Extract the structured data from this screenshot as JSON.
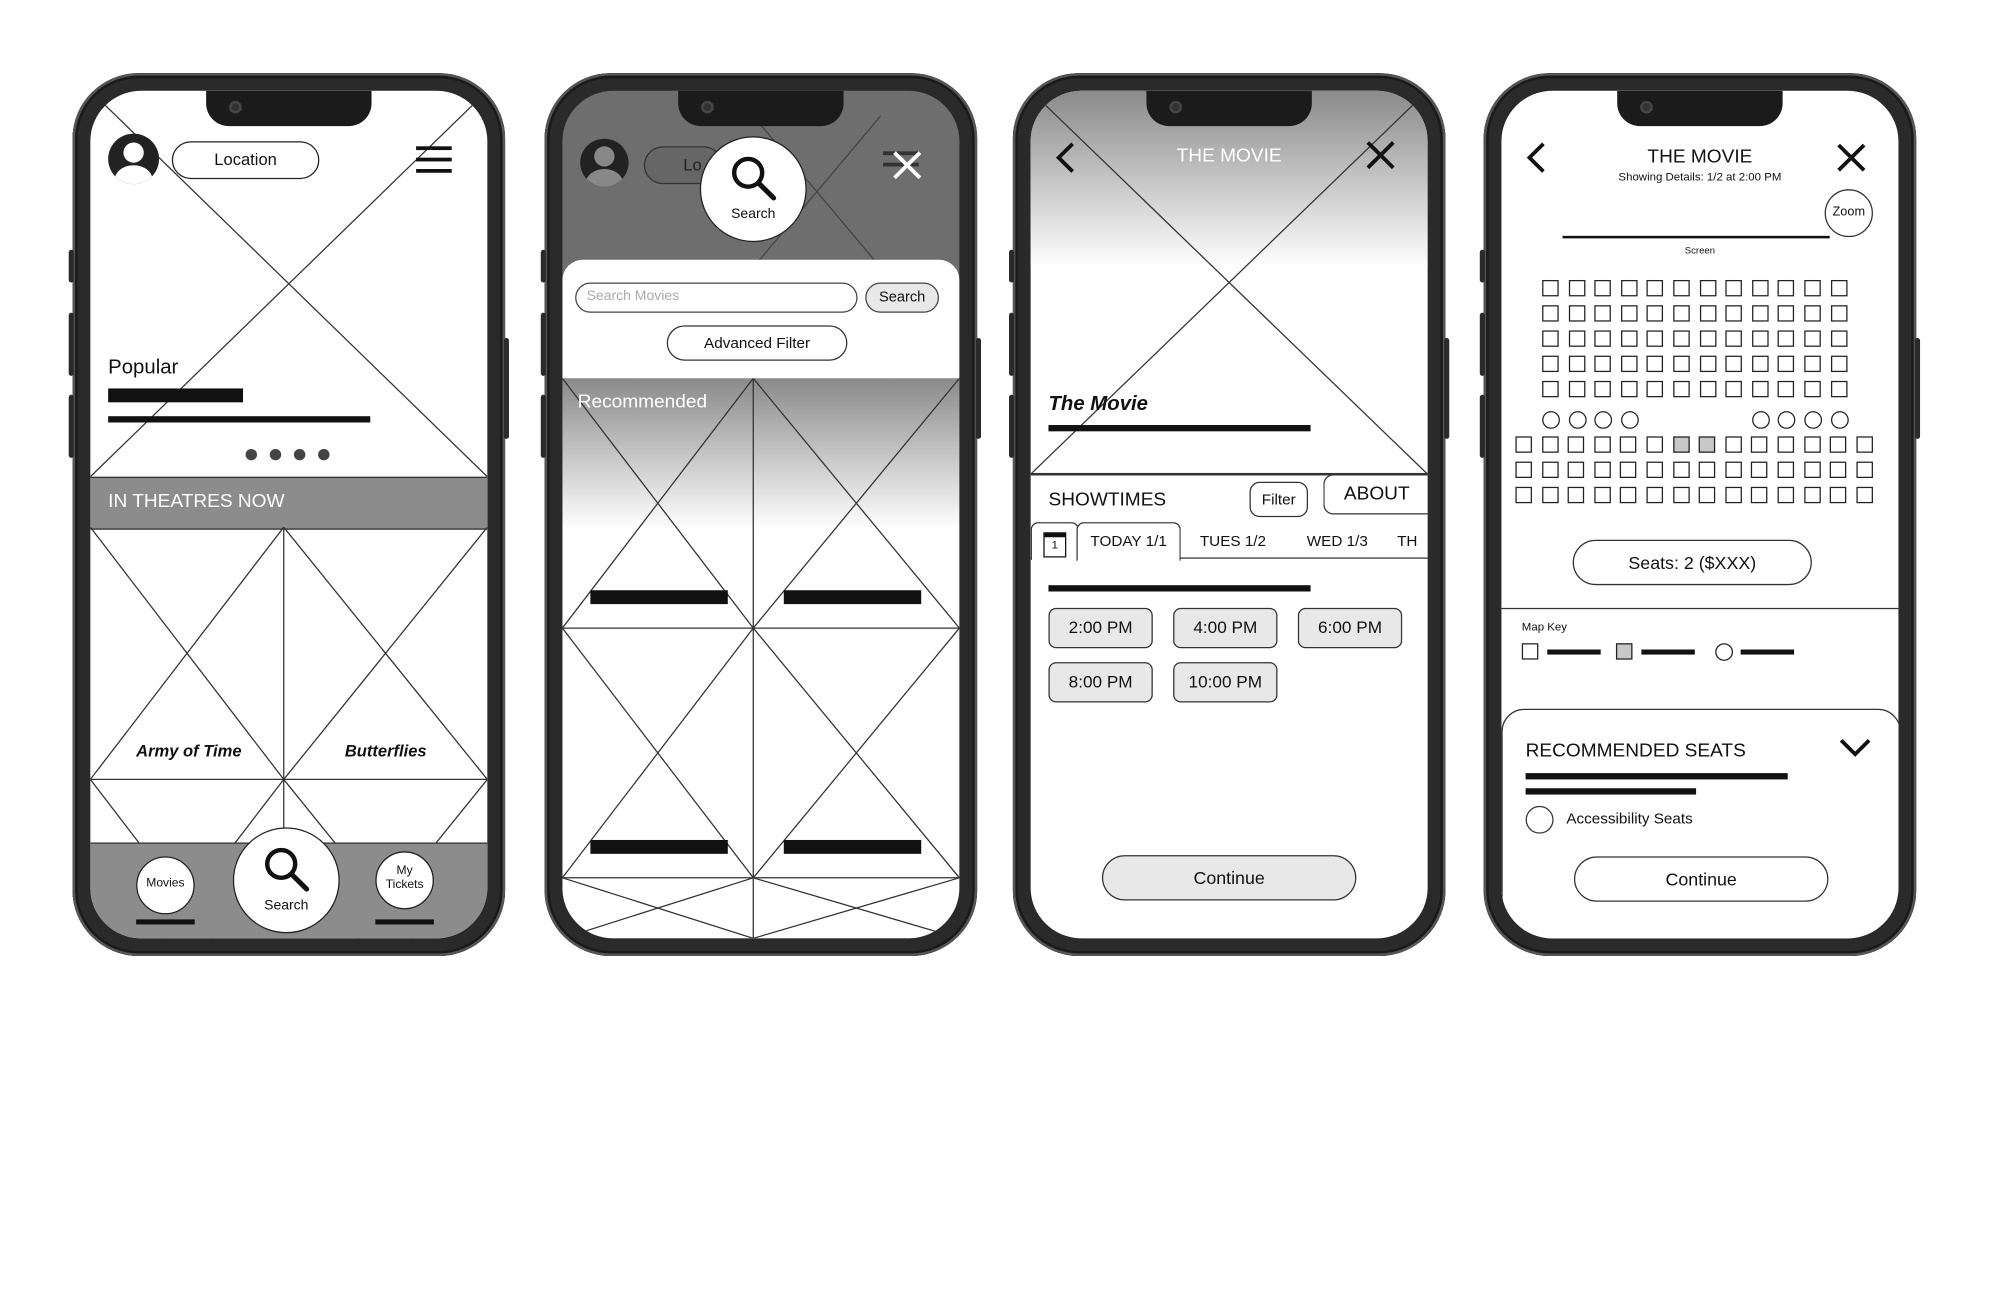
{
  "screen1": {
    "location_label": "Location",
    "popular_label": "Popular",
    "section_title": "IN THEATRES NOW",
    "movies": [
      "Army of Time",
      "Butterflies"
    ],
    "nav": {
      "movies": "Movies",
      "search": "Search",
      "tickets_line1": "My",
      "tickets_line2": "Tickets"
    }
  },
  "screen2": {
    "location_partial": "Lo",
    "search_bubble_label": "Search",
    "search_placeholder": "Search Movies",
    "search_button": "Search",
    "advanced_filter": "Advanced Filter",
    "recommended_label": "Recommended"
  },
  "screen3": {
    "header_title": "THE MOVIE",
    "movie_title": "The Movie",
    "showtimes_label": "SHOWTIMES",
    "filter_button": "Filter",
    "about_tab": "ABOUT",
    "calendar_day": "1",
    "date_tabs": [
      "TODAY 1/1",
      "TUES 1/2",
      "WED 1/3",
      "TH"
    ],
    "times": [
      "2:00 PM",
      "4:00 PM",
      "6:00 PM",
      "8:00 PM",
      "10:00 PM"
    ],
    "continue": "Continue"
  },
  "screen4": {
    "title": "THE MOVIE",
    "subtitle": "Showing Details: 1/2 at 2:00 PM",
    "zoom": "Zoom",
    "screen_label": "Screen",
    "seats_button": "Seats: 2 ($XXX)",
    "map_key": "Map Key",
    "recommended_title": "RECOMMENDED SEATS",
    "accessibility": "Accessibility Seats",
    "continue": "Continue"
  },
  "colors": {
    "frame": "#2a2a2a",
    "gray_band": "#888888",
    "button_gray": "#e8e8e8",
    "taken_seat": "#c8c8c8"
  }
}
